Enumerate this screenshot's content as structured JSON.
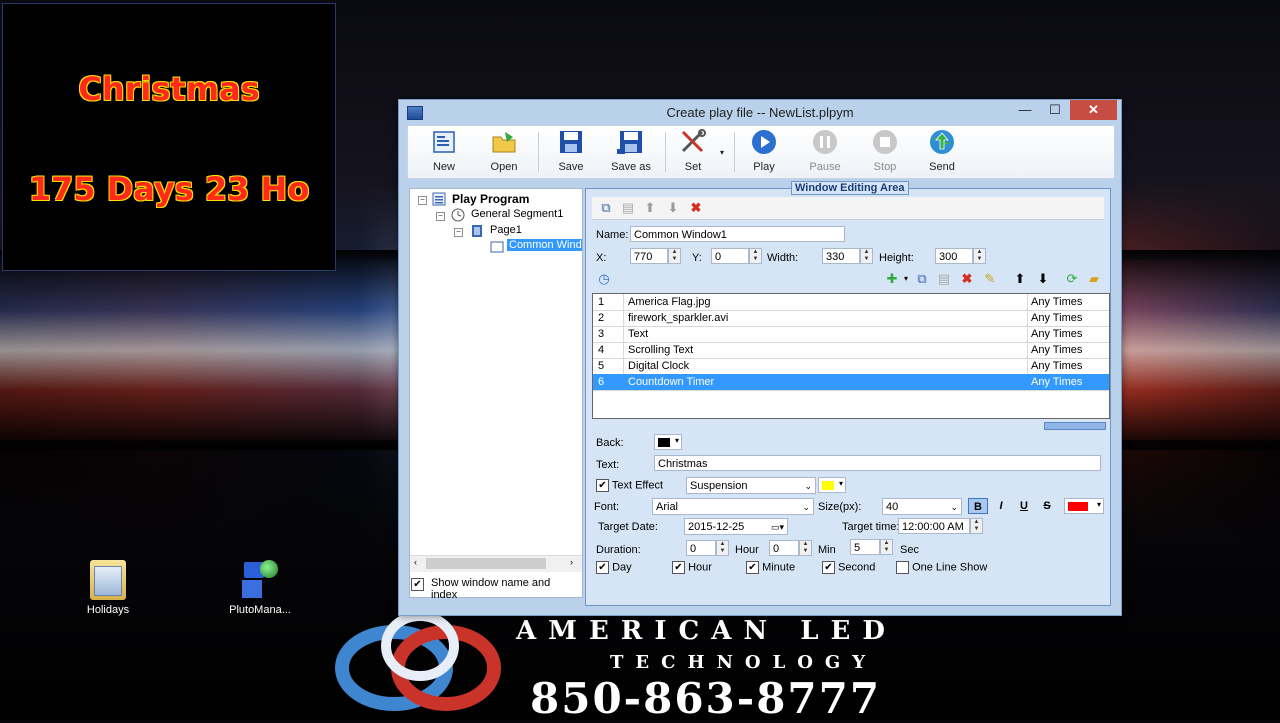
{
  "led": {
    "line1": "Christmas",
    "line2": "175 Days 23 Ho"
  },
  "desktop": {
    "icons": [
      {
        "label": "Holidays"
      },
      {
        "label": "PlutoMana..."
      }
    ]
  },
  "brand": {
    "line1": "AMERICAN LED",
    "line2": "TECHNOLOGY",
    "phone": "850-863-8777"
  },
  "window": {
    "title": "Create play file  --  NewList.plpym",
    "min": "—",
    "max": "☐",
    "close": "✕"
  },
  "toolbar": {
    "items": [
      {
        "label": "New"
      },
      {
        "label": "Open"
      },
      {
        "label": "Save"
      },
      {
        "label": "Save as"
      },
      {
        "label": "Set"
      },
      {
        "label": "Play"
      },
      {
        "label": "Pause"
      },
      {
        "label": "Stop"
      },
      {
        "label": "Send"
      }
    ]
  },
  "tree": {
    "root": "Play Program",
    "segment": "General Segment1",
    "page": "Page1",
    "window": "Common Window1",
    "show_label_1": "Show window name and",
    "show_label_2": "index"
  },
  "edit": {
    "group_title": "Window Editing Area",
    "name_label": "Name:",
    "name": "Common Window1",
    "x_label": "X:",
    "x": "770",
    "y_label": "Y:",
    "y": "0",
    "width_label": "Width:",
    "width": "330",
    "height_label": "Height:",
    "height": "300",
    "items": [
      {
        "index": "1",
        "name": "America Flag.jpg",
        "times": "Any Times"
      },
      {
        "index": "2",
        "name": "firework_sparkler.avi",
        "times": "Any Times"
      },
      {
        "index": "3",
        "name": "Text",
        "times": "Any Times"
      },
      {
        "index": "4",
        "name": "Scrolling Text",
        "times": "Any Times"
      },
      {
        "index": "5",
        "name": "Digital Clock",
        "times": "Any Times"
      },
      {
        "index": "6",
        "name": "Countdown Timer",
        "times": "Any Times"
      }
    ]
  },
  "props": {
    "back_label": "Back:",
    "text_label": "Text:",
    "text": "Christmas",
    "effect_label": "Text Effect",
    "effect": "Suspension",
    "font_label": "Font:",
    "font": "Arial",
    "size_label": "Size(px):",
    "size": "40",
    "bold": "B",
    "italic": "I",
    "underline": "U",
    "strike": "S",
    "target_date_label": "Target Date:",
    "target_date": "2015-12-25",
    "target_time_label": "Target time:",
    "target_time": "12:00:00 AM",
    "duration_label": "Duration:",
    "dur_hour": "0",
    "hour_unit": "Hour",
    "dur_min": "0",
    "min_unit": "Min",
    "dur_sec": "5",
    "sec_unit": "Sec",
    "day": "Day",
    "hour": "Hour",
    "minute": "Minute",
    "second": "Second",
    "one_line": "One Line Show",
    "colors": {
      "back": "#000000",
      "effect": "#ffff00",
      "font": "#ff0000"
    }
  }
}
